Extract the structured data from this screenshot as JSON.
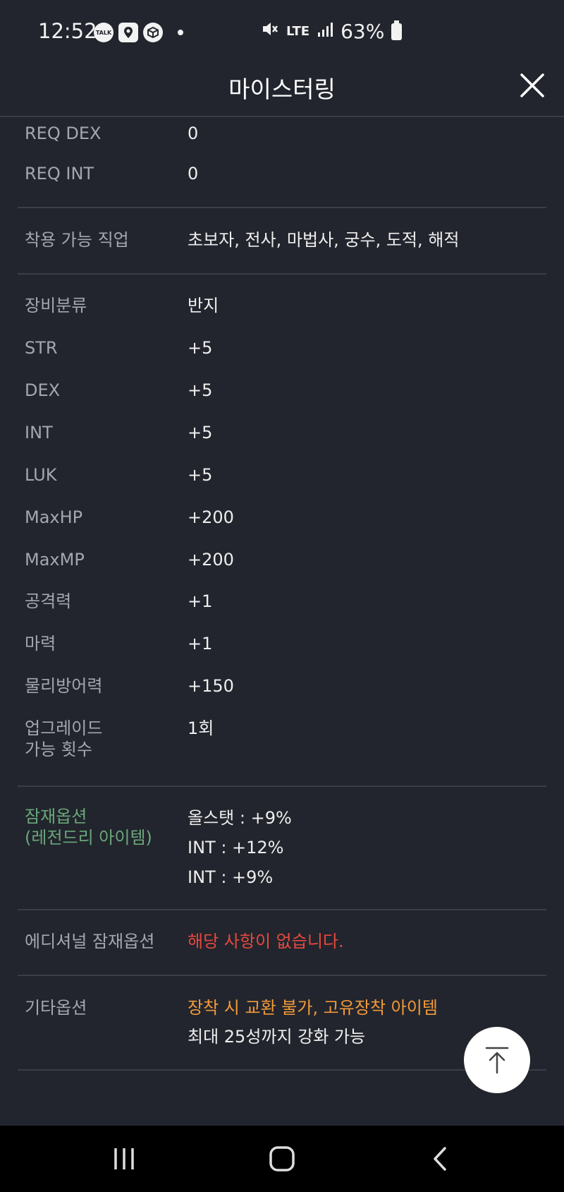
{
  "status_bar": {
    "time": "12:52",
    "talk_label": "TALK",
    "network": "LTE",
    "battery": "63%"
  },
  "header": {
    "title": "마이스터링"
  },
  "stats": {
    "req_dex": {
      "label": "REQ DEX",
      "value": "0"
    },
    "req_int": {
      "label": "REQ INT",
      "value": "0"
    },
    "jobs": {
      "label": "착용 가능 직업",
      "value": "초보자, 전사, 마법사, 궁수, 도적, 해적"
    },
    "category": {
      "label": "장비분류",
      "value": "반지"
    },
    "str": {
      "label": "STR",
      "value": "+5"
    },
    "dex": {
      "label": "DEX",
      "value": "+5"
    },
    "int": {
      "label": "INT",
      "value": "+5"
    },
    "luk": {
      "label": "LUK",
      "value": "+5"
    },
    "maxhp": {
      "label": "MaxHP",
      "value": "+200"
    },
    "maxmp": {
      "label": "MaxMP",
      "value": "+200"
    },
    "attack": {
      "label": "공격력",
      "value": "+1"
    },
    "magic": {
      "label": "마력",
      "value": "+1"
    },
    "defense": {
      "label": "물리방어력",
      "value": "+150"
    },
    "upgrades": {
      "label_line1": "업그레이드",
      "label_line2": "가능 횟수",
      "value": "1회"
    }
  },
  "potential": {
    "label_line1": "잠재옵션",
    "label_line2": "(레전드리 아이템)",
    "lines": [
      "올스탯 : +9%",
      "INT : +12%",
      "INT : +9%"
    ]
  },
  "additional_potential": {
    "label": "에디셔널 잠재옵션",
    "value": "해당 사항이 없습니다."
  },
  "other_options": {
    "label": "기타옵션",
    "line1": "장착 시 교환 불가, 고유장착 아이템",
    "line2": "최대 25성까지 강화 가능"
  },
  "colors": {
    "background": "#22252d",
    "legendary_green": "#6aa77a",
    "none_red": "#e8483e",
    "notice_orange": "#f29a3a"
  }
}
